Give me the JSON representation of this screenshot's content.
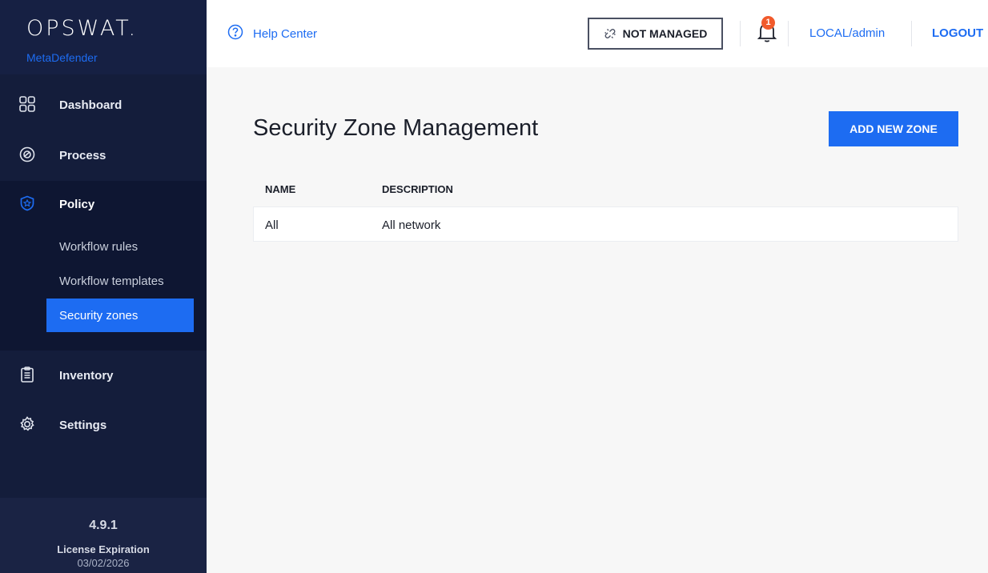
{
  "brand": {
    "name": "OPSWAT.",
    "product": "MetaDefender"
  },
  "sidebar": {
    "items": [
      {
        "label": "Dashboard",
        "icon": "dashboard-grid-icon"
      },
      {
        "label": "Process",
        "icon": "process-gauge-icon"
      },
      {
        "label": "Policy",
        "icon": "shield-star-icon"
      },
      {
        "label": "Inventory",
        "icon": "clipboard-icon"
      },
      {
        "label": "Settings",
        "icon": "gear-icon"
      }
    ],
    "policy_subitems": [
      {
        "label": "Workflow rules"
      },
      {
        "label": "Workflow templates"
      },
      {
        "label": "Security zones",
        "active": true
      }
    ],
    "version": "4.9.1",
    "license_label": "License Expiration",
    "license_date": "03/02/2026"
  },
  "topbar": {
    "help_label": "Help Center",
    "not_managed_label": "NOT MANAGED",
    "notification_count": "1",
    "user_label": "LOCAL/admin",
    "logout_label": "LOGOUT"
  },
  "main": {
    "title": "Security Zone Management",
    "add_button_label": "ADD NEW ZONE",
    "table": {
      "columns": [
        "NAME",
        "DESCRIPTION"
      ],
      "rows": [
        {
          "name": "All",
          "description": "All network"
        }
      ]
    }
  },
  "colors": {
    "accent": "#1d6cf2",
    "sidebar_bg": "#141d3b",
    "badge": "#f15a2b"
  }
}
